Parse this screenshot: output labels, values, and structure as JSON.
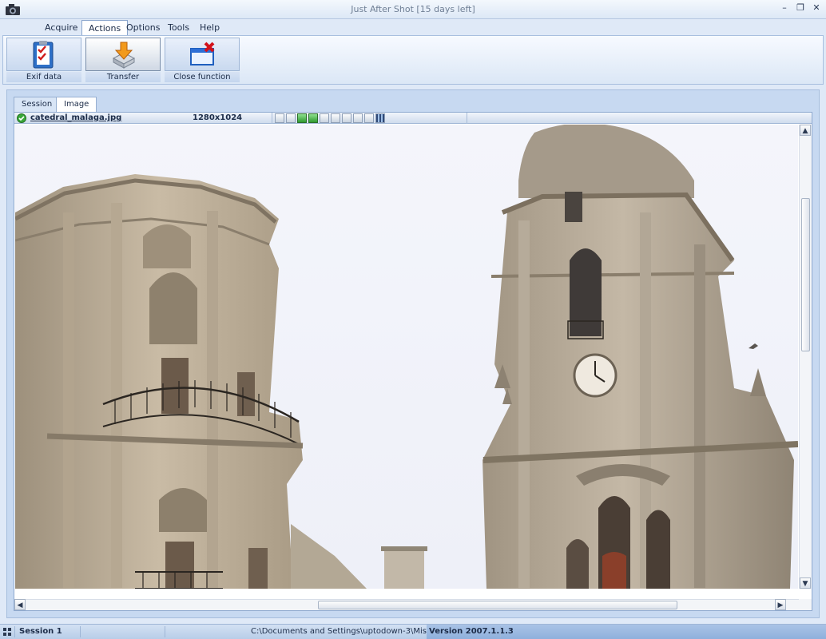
{
  "window": {
    "title": "Just After Shot [15 days left]",
    "controls": [
      "minimize",
      "restore",
      "close"
    ]
  },
  "menu": {
    "items": [
      {
        "label": "Acquire"
      },
      {
        "label": "Actions",
        "active": true
      },
      {
        "label": "Options"
      },
      {
        "label": "Tools"
      },
      {
        "label": "Help"
      }
    ]
  },
  "ribbon": {
    "buttons": [
      {
        "label": "Exif data",
        "icon": "clipboard-checklist-icon"
      },
      {
        "label": "Transfer",
        "icon": "transfer-arrow-icon",
        "pressed": true
      },
      {
        "label": "Close function",
        "icon": "close-window-icon"
      }
    ]
  },
  "tabs": [
    {
      "label": "Session"
    },
    {
      "label": "Image",
      "active": true
    }
  ],
  "image": {
    "filename": "catedral_malaga.jpg",
    "dimensions": "1280x1024",
    "content": "photo-cathedral-malaga"
  },
  "statusbar": {
    "session": "Session 1",
    "path": "C:\\Documents and Settings\\uptodown-3\\Mis",
    "version": "Version 2007.1.1.3"
  },
  "colors": {
    "accent": "#1f3f8a",
    "frame": "#c7d9f1",
    "sky": "#fbfbfe",
    "stone": "#b9a891"
  }
}
